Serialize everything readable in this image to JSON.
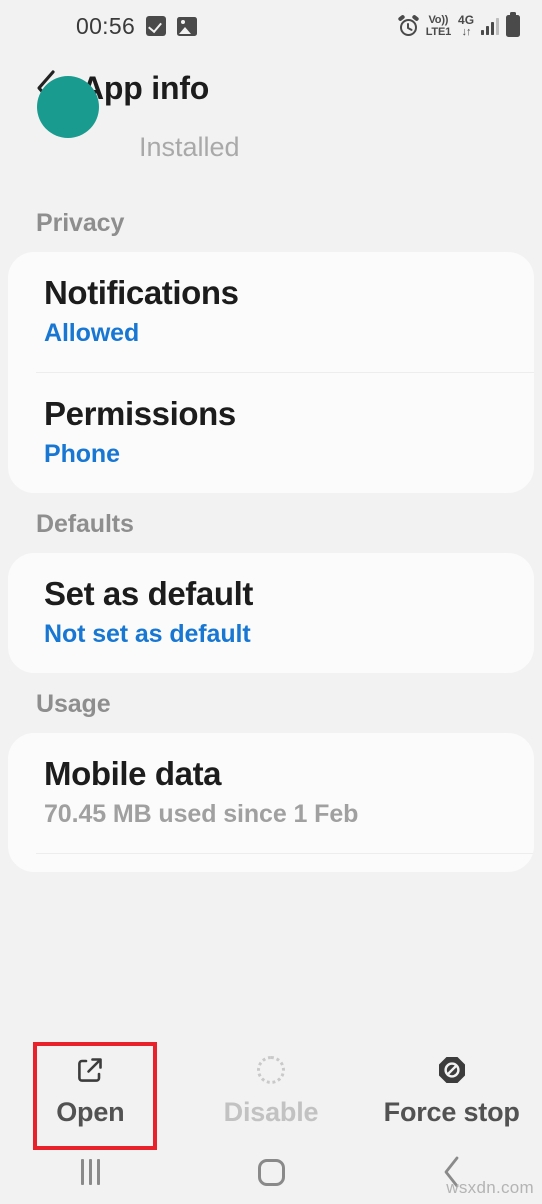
{
  "status_bar": {
    "time": "00:56",
    "left_icons": [
      "checkbox-icon",
      "image-icon"
    ],
    "network_label_line1": "Vo))",
    "network_label_line2": "LTE1",
    "data_type": "4G",
    "data_arrows": "↓↑",
    "right_icons": [
      "alarm-icon",
      "volte-icon",
      "4g-icon",
      "signal-icon",
      "battery-icon"
    ]
  },
  "app_bar": {
    "back_icon": "chevron-left-icon",
    "title": "App info"
  },
  "app_header": {
    "status_text": "Installed",
    "icon_color": "#1a9b8f"
  },
  "sections": [
    {
      "label": "Privacy",
      "rows": [
        {
          "title": "Notifications",
          "subtitle": "Allowed",
          "subtitle_style": "link"
        },
        {
          "title": "Permissions",
          "subtitle": "Phone",
          "subtitle_style": "link"
        }
      ]
    },
    {
      "label": "Defaults",
      "rows": [
        {
          "title": "Set as default",
          "subtitle": "Not set as default",
          "subtitle_style": "link"
        }
      ]
    },
    {
      "label": "Usage",
      "rows": [
        {
          "title": "Mobile data",
          "subtitle": "70.45 MB used since 1 Feb",
          "subtitle_style": "muted"
        }
      ]
    }
  ],
  "actions": [
    {
      "label": "Open",
      "icon": "external-link-icon",
      "enabled": true,
      "highlighted": true
    },
    {
      "label": "Disable",
      "icon": "dotted-circle-icon",
      "enabled": false,
      "highlighted": false
    },
    {
      "label": "Force stop",
      "icon": "block-octagon-icon",
      "enabled": true,
      "highlighted": false
    }
  ],
  "nav_bar": {
    "recents": "recents-icon",
    "home": "home-icon",
    "back": "back-icon"
  },
  "watermark": "wsxdn.com",
  "colors": {
    "accent_link": "#1877d2",
    "highlight": "#e8212a",
    "background": "#f2f2f2",
    "card": "#fbfbfb"
  }
}
